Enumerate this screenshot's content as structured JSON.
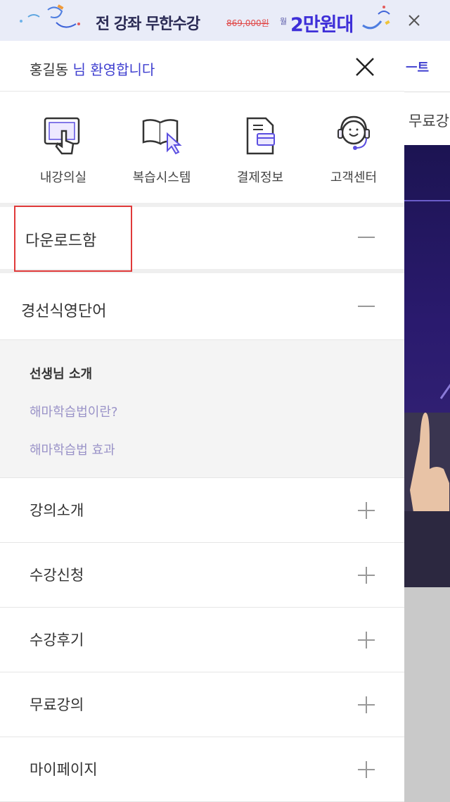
{
  "banner": {
    "headline": "전 강좌 무한수강",
    "old_price": "869,000원",
    "month_label": "월",
    "price": "2만원대"
  },
  "background": {
    "top_link": "ㅡ트",
    "menu_item": "무료강"
  },
  "drawer": {
    "user_name": "홍길동",
    "greeting": " 님 환영합니다"
  },
  "quick_menu": [
    {
      "label": "내강의실",
      "icon": "tablet-touch-icon"
    },
    {
      "label": "복습시스템",
      "icon": "book-cursor-icon"
    },
    {
      "label": "결제정보",
      "icon": "document-card-icon"
    },
    {
      "label": "고객센터",
      "icon": "headset-agent-icon"
    }
  ],
  "sections": {
    "download": "다운로드함",
    "course_series": "경선식영단어",
    "sub_items": [
      "선생님 소개",
      "해마학습법이란?",
      "해마학습법 효과"
    ]
  },
  "rows": [
    {
      "label": "강의소개"
    },
    {
      "label": "수강신청"
    },
    {
      "label": "수강후기"
    },
    {
      "label": "무료강의"
    },
    {
      "label": "마이페이지"
    }
  ],
  "colors": {
    "accent": "#3d3dcf",
    "banner_bg": "#e9ecf8",
    "highlight": "#e03a3a"
  }
}
